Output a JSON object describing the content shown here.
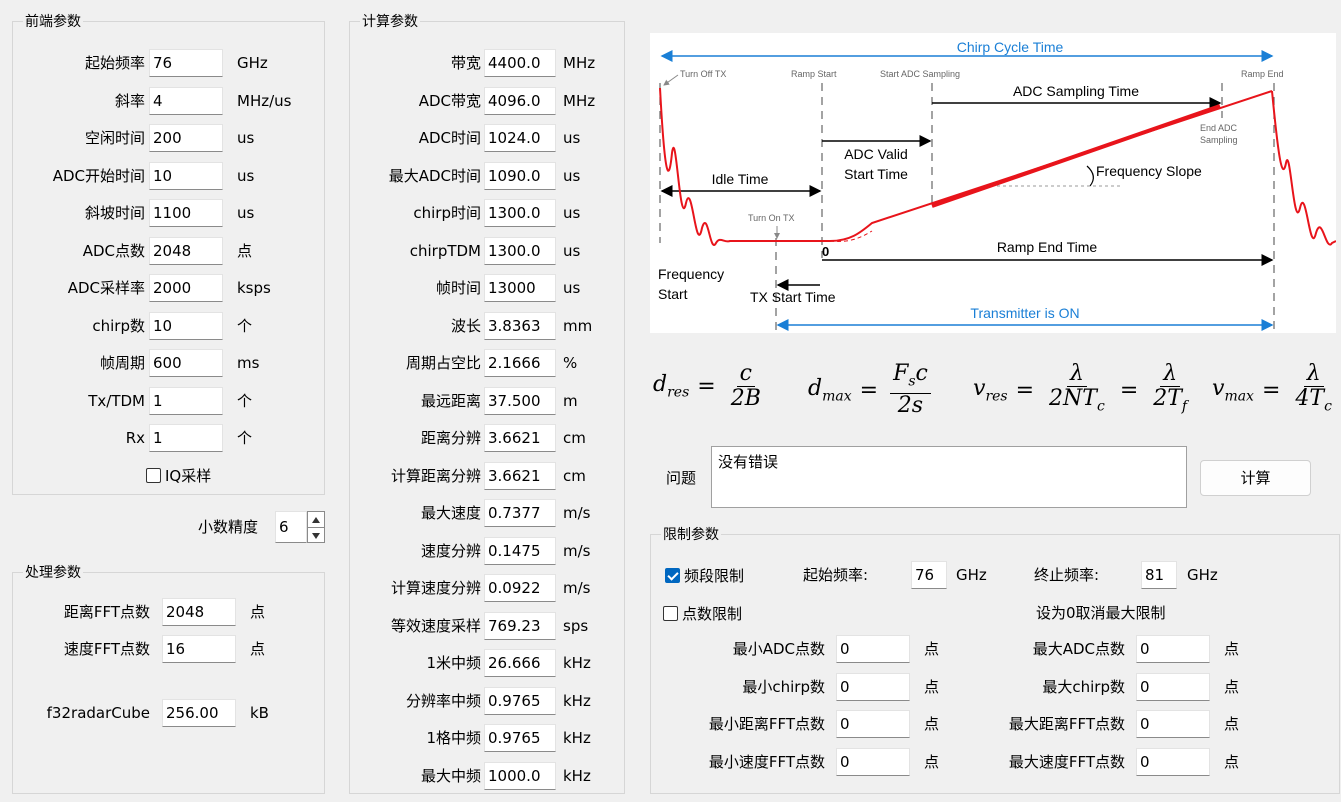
{
  "frontend": {
    "title": "前端参数",
    "rows": [
      {
        "label": "起始频率",
        "value": "76",
        "unit": "GHz"
      },
      {
        "label": "斜率",
        "value": "4",
        "unit": "MHz/us"
      },
      {
        "label": "空闲时间",
        "value": "200",
        "unit": "us"
      },
      {
        "label": "ADC开始时间",
        "value": "10",
        "unit": "us"
      },
      {
        "label": "斜坡时间",
        "value": "1100",
        "unit": "us"
      },
      {
        "label": "ADC点数",
        "value": "2048",
        "unit": "点"
      },
      {
        "label": "ADC采样率",
        "value": "2000",
        "unit": "ksps"
      },
      {
        "label": "chirp数",
        "value": "10",
        "unit": "个"
      },
      {
        "label": "帧周期",
        "value": "600",
        "unit": "ms"
      },
      {
        "label": "Tx/TDM",
        "value": "1",
        "unit": "个"
      },
      {
        "label": "Rx",
        "value": "1",
        "unit": "个"
      }
    ],
    "iq_label": "IQ采样",
    "iq_checked": false
  },
  "precision": {
    "label": "小数精度",
    "value": "6"
  },
  "processing": {
    "title": "处理参数",
    "rows": [
      {
        "label": "距离FFT点数",
        "value": "2048",
        "unit": "点"
      },
      {
        "label": "速度FFT点数",
        "value": "16",
        "unit": "点"
      },
      {
        "label": "f32radarCube",
        "value": "256.00",
        "unit": "kB"
      }
    ]
  },
  "calc": {
    "title": "计算参数",
    "rows": [
      {
        "label": "带宽",
        "value": "4400.0",
        "unit": "MHz"
      },
      {
        "label": "ADC带宽",
        "value": "4096.0",
        "unit": "MHz"
      },
      {
        "label": "ADC时间",
        "value": "1024.0",
        "unit": "us"
      },
      {
        "label": "最大ADC时间",
        "value": "1090.0",
        "unit": "us"
      },
      {
        "label": "chirp时间",
        "value": "1300.0",
        "unit": "us"
      },
      {
        "label": "chirpTDM",
        "value": "1300.0",
        "unit": "us"
      },
      {
        "label": "帧时间",
        "value": "13000",
        "unit": "us"
      },
      {
        "label": "波长",
        "value": "3.8363",
        "unit": "mm"
      },
      {
        "label": "周期占空比",
        "value": "2.1666",
        "unit": "%"
      },
      {
        "label": "最远距离",
        "value": "37.500",
        "unit": "m"
      },
      {
        "label": "距离分辨",
        "value": "3.6621",
        "unit": "cm"
      },
      {
        "label": "计算距离分辨",
        "value": "3.6621",
        "unit": "cm"
      },
      {
        "label": "最大速度",
        "value": "0.7377",
        "unit": "m/s"
      },
      {
        "label": "速度分辨",
        "value": "0.1475",
        "unit": "m/s"
      },
      {
        "label": "计算速度分辨",
        "value": "0.0922",
        "unit": "m/s"
      },
      {
        "label": "等效速度采样",
        "value": "769.23",
        "unit": "sps"
      },
      {
        "label": "1米中频",
        "value": "26.666",
        "unit": "kHz"
      },
      {
        "label": "分辨率中频",
        "value": "0.9765",
        "unit": "kHz"
      },
      {
        "label": "1格中频",
        "value": "0.9765",
        "unit": "kHz"
      },
      {
        "label": "最大中频",
        "value": "1000.0",
        "unit": "kHz"
      }
    ]
  },
  "diagram": {
    "chirp_cycle_time": "Chirp Cycle Time",
    "turn_off_tx": "Turn Off TX",
    "ramp_start": "Ramp Start",
    "start_adc_sampling": "Start ADC Sampling",
    "ramp_end": "Ramp End",
    "adc_sampling_time": "ADC Sampling Time",
    "end_adc_sampling_1": "End ADC",
    "end_adc_sampling_2": "Sampling",
    "adc_valid_1": "ADC Valid",
    "adc_valid_2": "Start Time",
    "idle_time": "Idle Time",
    "frequency_slope": "Frequency Slope",
    "turn_on_tx": "Turn On TX",
    "zero": "0",
    "ramp_end_time": "Ramp End Time",
    "frequency_start_1": "Frequency",
    "frequency_start_2": "Start",
    "tx_start_time": "TX Start Time",
    "transmitter_on": "Transmitter is ON",
    "colors": {
      "accent": "#1a7fd6",
      "signal": "#e8141b"
    }
  },
  "formulas": {
    "d_res": {
      "lhs": "d",
      "sub": "res",
      "num": "c",
      "den": "2B"
    },
    "d_max": {
      "lhs": "d",
      "sub": "max",
      "num_a": "F",
      "num_sub": "s",
      "num_b": "c",
      "den": "2s"
    },
    "v_res": {
      "lhs": "v",
      "sub": "res",
      "num": "λ",
      "den_a": "2NT",
      "den_sub": "c",
      "num2": "λ",
      "den2_a": "2T",
      "den2_sub": "f"
    },
    "v_max": {
      "lhs": "v",
      "sub": "max",
      "num": "λ",
      "den_a": "4T",
      "den_sub": "c"
    }
  },
  "problem": {
    "label": "问题",
    "text": "没有错误",
    "calc_button": "计算"
  },
  "limits": {
    "title": "限制参数",
    "band_limit_label": "频段限制",
    "band_limit_checked": true,
    "start_freq_label": "起始频率:",
    "start_freq_value": "76",
    "start_freq_unit": "GHz",
    "end_freq_label": "终止频率:",
    "end_freq_value": "81",
    "end_freq_unit": "GHz",
    "points_limit_label": "点数限制",
    "points_limit_checked": false,
    "zero_hint": "设为0取消最大限制",
    "left": [
      {
        "label": "最小ADC点数",
        "value": "0",
        "unit": "点"
      },
      {
        "label": "最小chirp数",
        "value": "0",
        "unit": "点"
      },
      {
        "label": "最小距离FFT点数",
        "value": "0",
        "unit": "点"
      },
      {
        "label": "最小速度FFT点数",
        "value": "0",
        "unit": "点"
      }
    ],
    "right": [
      {
        "label": "最大ADC点数",
        "value": "0",
        "unit": "点"
      },
      {
        "label": "最大chirp数",
        "value": "0",
        "unit": "点"
      },
      {
        "label": "最大距离FFT点数",
        "value": "0",
        "unit": "点"
      },
      {
        "label": "最大速度FFT点数",
        "value": "0",
        "unit": "点"
      }
    ]
  }
}
